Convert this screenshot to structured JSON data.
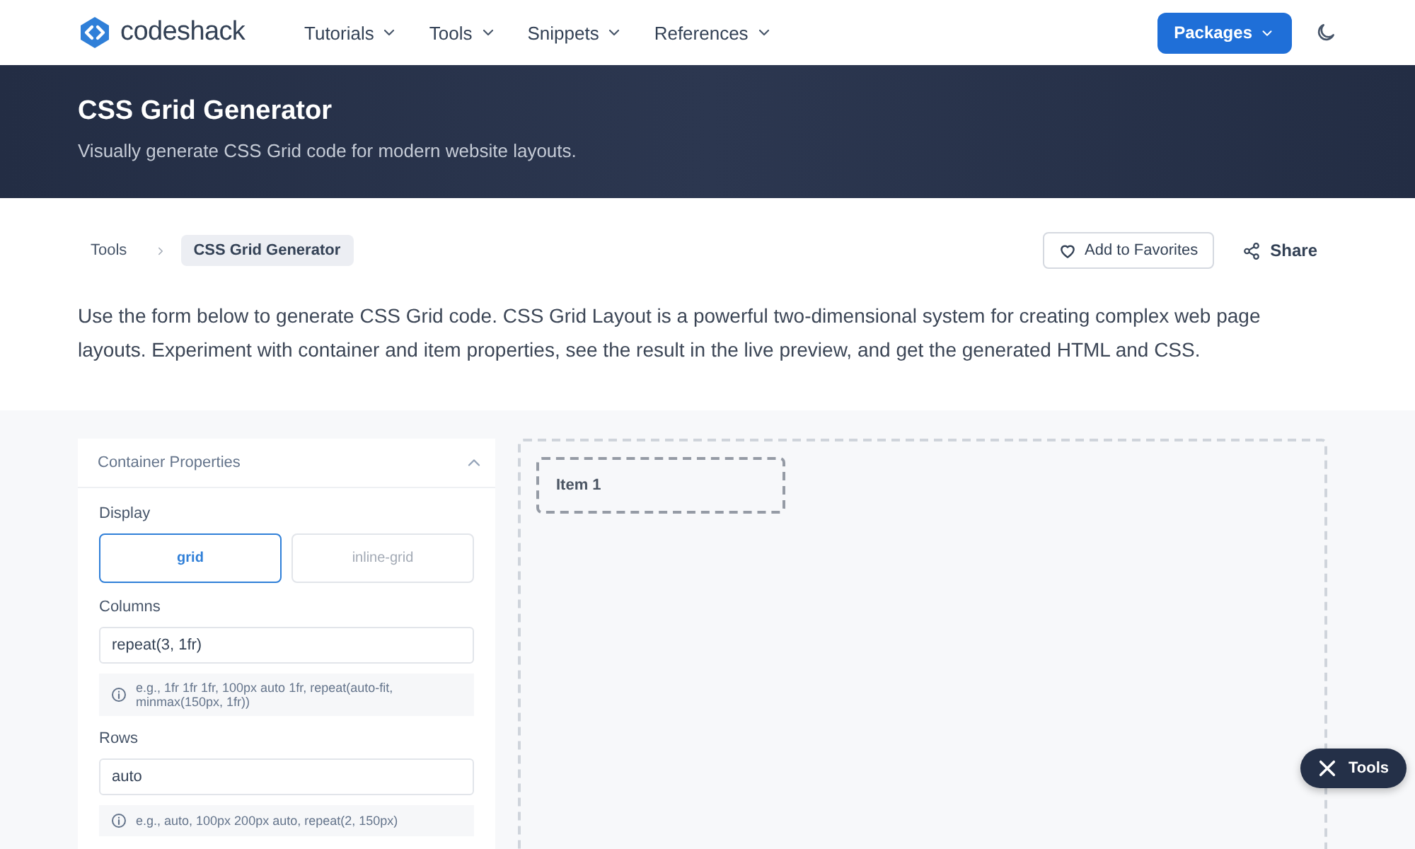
{
  "header": {
    "logo": "codeshack",
    "nav": [
      {
        "label": "Tutorials"
      },
      {
        "label": "Tools"
      },
      {
        "label": "Snippets"
      },
      {
        "label": "References"
      }
    ],
    "packages_button": "Packages"
  },
  "hero": {
    "title": "CSS Grid Generator",
    "subtitle": "Visually generate CSS Grid code for modern website layouts."
  },
  "breadcrumb": [
    {
      "label": "Tools",
      "selected": false
    },
    {
      "label": "CSS Grid Generator",
      "selected": true
    }
  ],
  "actions": {
    "favorite": "Add to Favorites",
    "share": "Share"
  },
  "intro": "Use the form below to generate CSS Grid code. CSS Grid Layout is a powerful two-dimensional system for creating complex web page layouts. Experiment with container and item properties, see the result in the live preview, and get the generated HTML and CSS.",
  "panel": {
    "title": "Container Properties",
    "expanded": true,
    "display": {
      "label": "Display",
      "options": [
        {
          "label": "grid",
          "selected": true
        },
        {
          "label": "inline-grid",
          "selected": false
        }
      ]
    },
    "fields": [
      {
        "label": "Columns",
        "value": "repeat(3, 1fr)",
        "hint": "e.g., 1fr 1fr 1fr, 100px auto 1fr, repeat(auto-fit, minmax(150px, 1fr))"
      },
      {
        "label": "Rows",
        "value": "auto",
        "hint": "e.g., auto, 100px 200px auto, repeat(2, 150px)"
      }
    ]
  },
  "preview": {
    "items": [
      "Item 1"
    ]
  },
  "tools_button": "Tools"
}
